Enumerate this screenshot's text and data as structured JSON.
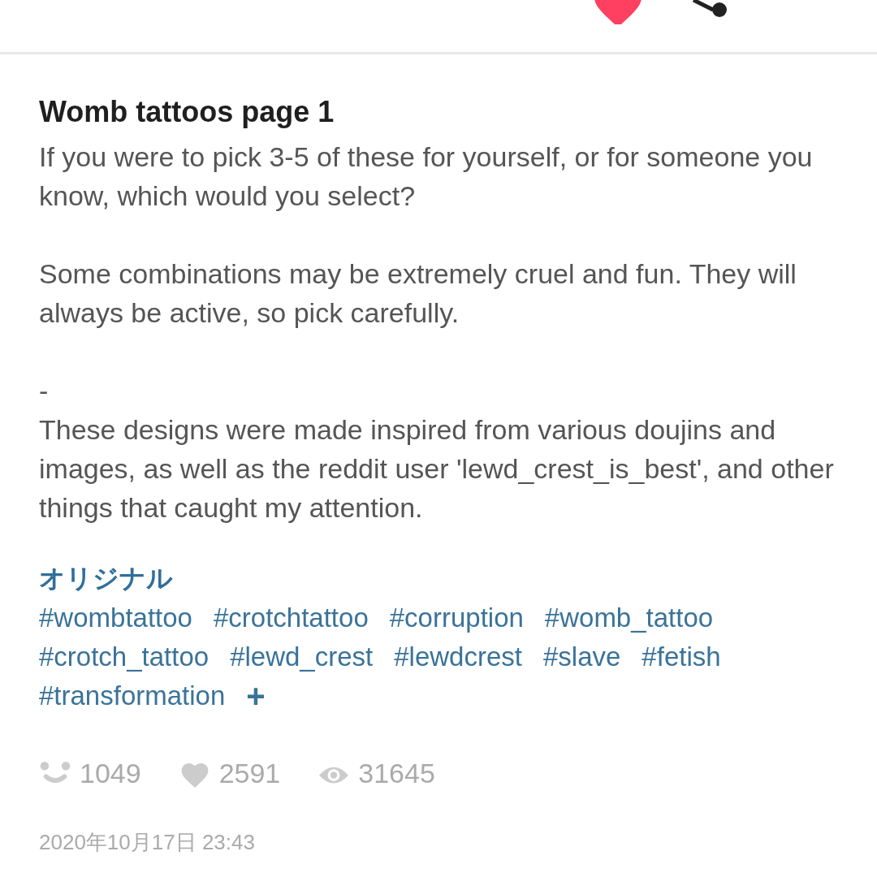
{
  "top_bar": {
    "liked": true
  },
  "title": "Womb tattoos page 1",
  "description": "If you were to pick 3-5 of these for yourself, or for someone you know, which would you select?\n\nSome combinations may be extremely cruel and fun. They will always be active, so pick carefully.\n\n-\nThese designs were made inspired from various doujins and images, as well as the reddit user 'lewd_crest_is_best', and other things that caught my attention.",
  "original_label": "オリジナル",
  "tags": [
    "#wombtattoo",
    "#crotchtattoo",
    "#corruption",
    "#womb_tattoo",
    "#crotch_tattoo",
    "#lewd_crest",
    "#lewdcrest",
    "#slave",
    "#fetish",
    "#transformation"
  ],
  "add_tag": "+",
  "stats": [
    {
      "kind": "comments",
      "value": "1049"
    },
    {
      "kind": "likes",
      "value": "2591"
    },
    {
      "kind": "views",
      "value": "31645"
    }
  ],
  "date": "2020年10月17日 23:43"
}
